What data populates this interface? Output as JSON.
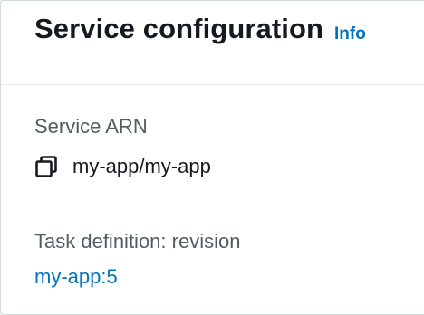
{
  "panel": {
    "title": "Service configuration",
    "info_label": "Info"
  },
  "fields": {
    "service_arn": {
      "label": "Service ARN",
      "value": "my-app/my-app",
      "copy_icon": "copy-icon"
    },
    "task_definition": {
      "label": "Task definition: revision",
      "value": "my-app:5"
    }
  },
  "colors": {
    "link": "#0073bb",
    "heading": "#16191f",
    "label": "#545b64",
    "divider": "#eaeded"
  }
}
